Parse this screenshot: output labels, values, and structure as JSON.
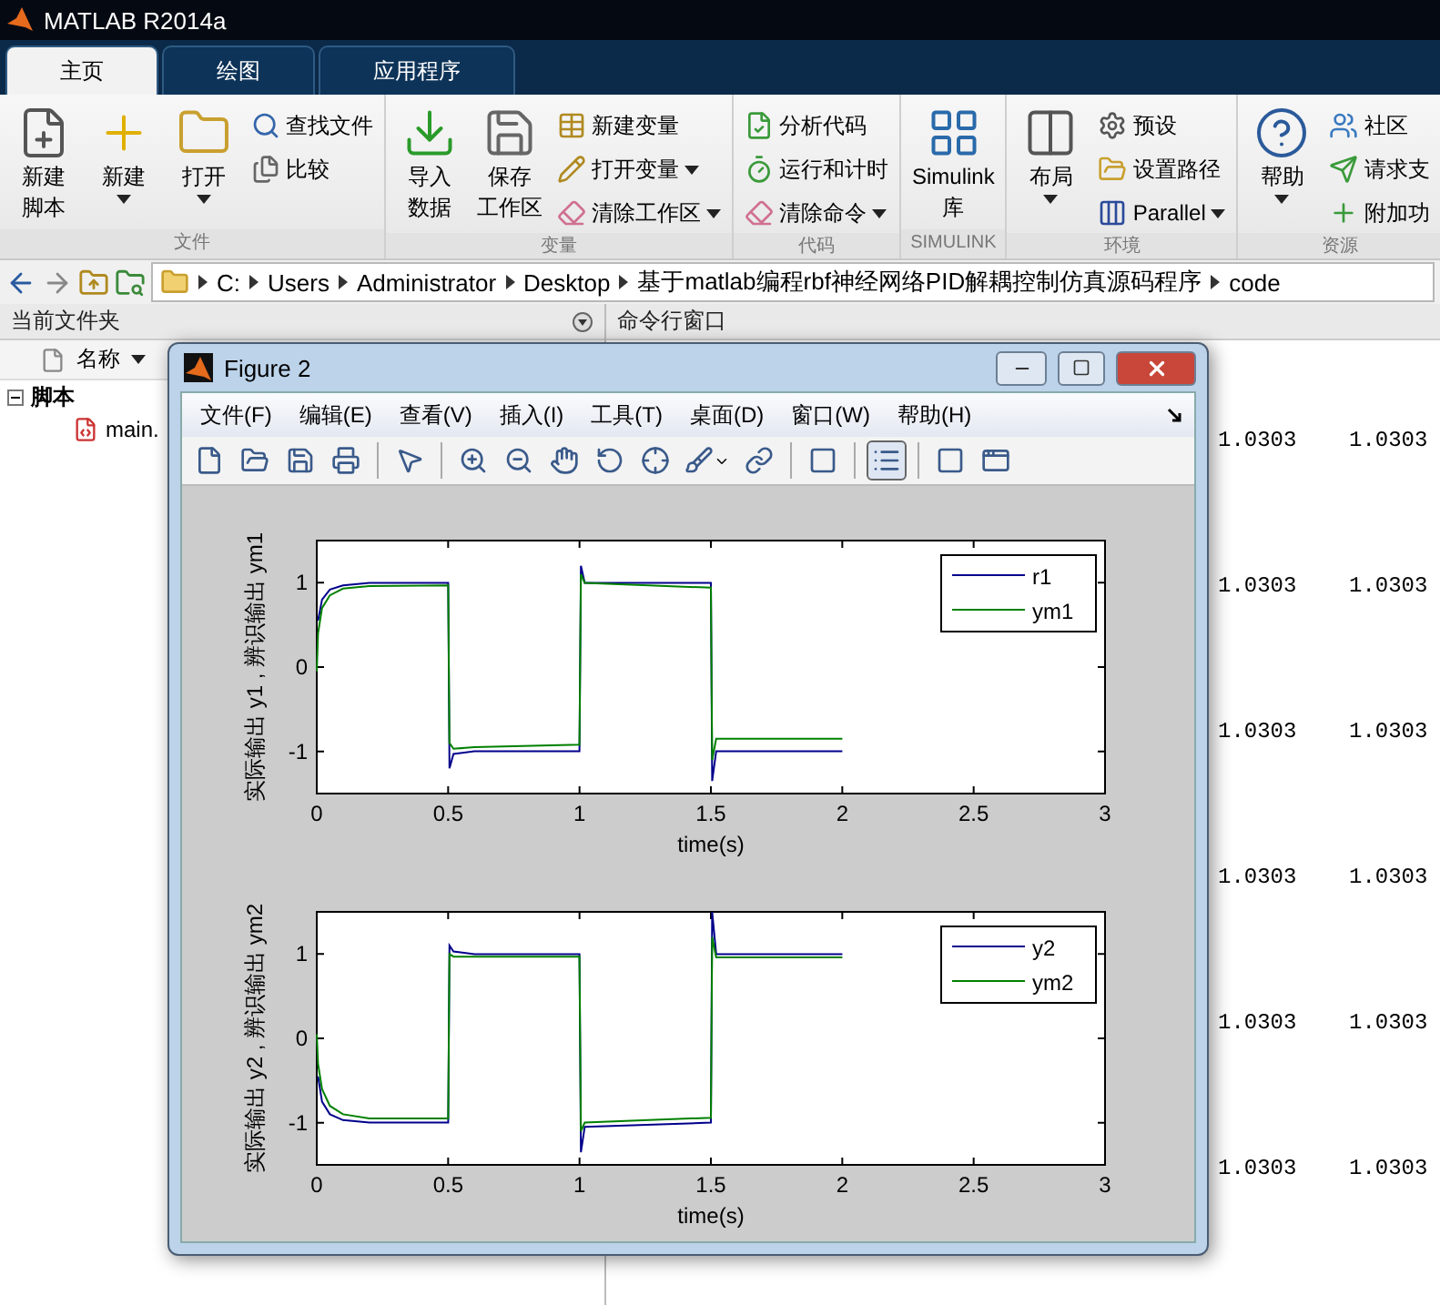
{
  "window": {
    "title": "MATLAB R2014a"
  },
  "tabs": [
    {
      "label": "主页",
      "selected": true
    },
    {
      "label": "绘图",
      "selected": false
    },
    {
      "label": "应用程序",
      "selected": false
    }
  ],
  "ribbon": [
    {
      "label": "文件",
      "items": [
        {
          "kind": "large",
          "lines": [
            "新建",
            "脚本"
          ],
          "dropdown": false
        },
        {
          "kind": "large",
          "lines": [
            "新建"
          ],
          "dropdown": true
        },
        {
          "kind": "large",
          "lines": [
            "打开"
          ],
          "dropdown": true
        },
        {
          "kind": "stack",
          "entries": [
            {
              "label": "查找文件",
              "dropdown": false
            },
            {
              "label": "比较",
              "dropdown": false
            }
          ]
        }
      ]
    },
    {
      "label": "变量",
      "items": [
        {
          "kind": "large",
          "lines": [
            "导入",
            "数据"
          ],
          "dropdown": false
        },
        {
          "kind": "large",
          "lines": [
            "保存",
            "工作区"
          ],
          "dropdown": false
        },
        {
          "kind": "stack",
          "entries": [
            {
              "label": "新建变量",
              "dropdown": false
            },
            {
              "label": "打开变量",
              "dropdown": true
            },
            {
              "label": "清除工作区",
              "dropdown": true
            }
          ]
        }
      ]
    },
    {
      "label": "代码",
      "items": [
        {
          "kind": "stack",
          "entries": [
            {
              "label": "分析代码",
              "dropdown": false
            },
            {
              "label": "运行和计时",
              "dropdown": false
            },
            {
              "label": "清除命令",
              "dropdown": true
            }
          ]
        }
      ]
    },
    {
      "label": "SIMULINK",
      "items": [
        {
          "kind": "large",
          "lines": [
            "Simulink",
            "库"
          ],
          "dropdown": false
        }
      ]
    },
    {
      "label": "环境",
      "items": [
        {
          "kind": "large",
          "lines": [
            "布局"
          ],
          "dropdown": true
        },
        {
          "kind": "stack",
          "entries": [
            {
              "label": "预设",
              "dropdown": false
            },
            {
              "label": "设置路径",
              "dropdown": false
            },
            {
              "label": "Parallel",
              "dropdown": true
            }
          ]
        }
      ]
    },
    {
      "label": "资源",
      "items": [
        {
          "kind": "large",
          "lines": [
            "帮助"
          ],
          "dropdown": true
        },
        {
          "kind": "stack",
          "entries": [
            {
              "label": "社区",
              "dropdown": false
            },
            {
              "label": "请求支",
              "dropdown": false
            },
            {
              "label": "附加功",
              "dropdown": false
            }
          ]
        }
      ]
    }
  ],
  "address": [
    "C:",
    "Users",
    "Administrator",
    "Desktop",
    "基于matlab编程rbf神经网络PID解耦控制仿真源码程序",
    "code"
  ],
  "current_folder": {
    "title": "当前文件夹",
    "column": "名称",
    "tree": [
      {
        "label": "脚本",
        "expanded": true,
        "children": [
          {
            "label": "main."
          }
        ]
      }
    ]
  },
  "command_window": {
    "title": "命令行窗口",
    "rows": [
      [
        "1.0303",
        "1.0303"
      ],
      [
        "1.0303",
        "1.0303"
      ],
      [
        "1.0303",
        "1.0303"
      ],
      [
        "1.0303",
        "1.0303"
      ],
      [
        "1.0303",
        "1.0303"
      ],
      [
        "1.0303",
        "1.0303"
      ]
    ]
  },
  "figure": {
    "title": "Figure 2",
    "menus": [
      "文件(F)",
      "编辑(E)",
      "查看(V)",
      "插入(I)",
      "工具(T)",
      "桌面(D)",
      "窗口(W)",
      "帮助(H)"
    ],
    "toolbar": [
      {
        "pressed": false
      },
      {
        "pressed": false
      },
      {
        "pressed": false
      },
      {
        "pressed": false
      },
      {
        "pressed": false
      },
      {
        "pressed": false
      },
      {
        "pressed": false
      },
      {
        "pressed": false
      },
      {
        "pressed": false
      },
      {
        "pressed": false
      },
      {
        "pressed": false
      },
      {
        "pressed": false
      },
      {
        "pressed": false
      },
      {
        "pressed": true
      },
      {
        "pressed": false
      },
      {
        "pressed": false
      }
    ],
    "axes": [
      {
        "chart_data": {
          "type": "line",
          "xlabel": "time(s)",
          "ylabel": "实际输出 y1 , 辨识输出 ym1",
          "x": [
            0,
            0.005,
            0.02,
            0.05,
            0.1,
            0.2,
            0.5,
            0.505,
            0.52,
            0.6,
            1.0,
            1.005,
            1.02,
            1.5,
            1.505,
            1.52,
            2.0
          ],
          "series": [
            {
              "name": "r1",
              "color": "#00008b",
              "values": [
                null,
                0.55,
                0.8,
                0.92,
                0.97,
                1,
                1,
                -1.2,
                -1.03,
                -1,
                -1,
                1.2,
                1.0,
                1.0,
                -1.35,
                -1.0,
                -1.0
              ]
            },
            {
              "name": "ym1",
              "color": "#008000",
              "values": [
                -0.05,
                0.4,
                0.7,
                0.85,
                0.93,
                0.96,
                0.97,
                -0.9,
                -0.97,
                -0.95,
                -0.92,
                1.1,
                1.0,
                0.94,
                -1.1,
                -0.85,
                -0.85
              ]
            }
          ],
          "legend": "upper right",
          "xlim": [
            0,
            3
          ],
          "ylim": [
            -1.5,
            1.5
          ],
          "xticks": [
            0,
            0.5,
            1,
            1.5,
            2,
            2.5,
            3
          ],
          "yticks": [
            -1,
            0,
            1
          ]
        }
      },
      {
        "chart_data": {
          "type": "line",
          "xlabel": "time(s)",
          "ylabel": "实际输出 y2 , 辨识输出 ym2",
          "x": [
            0,
            0.005,
            0.02,
            0.05,
            0.1,
            0.2,
            0.5,
            0.505,
            0.52,
            0.6,
            1.0,
            1.005,
            1.02,
            1.5,
            1.505,
            1.52,
            2.0
          ],
          "series": [
            {
              "name": "y2",
              "color": "#00008b",
              "values": [
                null,
                -0.45,
                -0.75,
                -0.9,
                -0.97,
                -1,
                -1,
                1.1,
                1.03,
                1,
                1,
                -1.35,
                -1.05,
                -1.0,
                1.5,
                1.0,
                1.0
              ]
            },
            {
              "name": "ym2",
              "color": "#008000",
              "values": [
                0.05,
                -0.3,
                -0.6,
                -0.8,
                -0.9,
                -0.95,
                -0.95,
                1.0,
                0.97,
                0.97,
                0.97,
                -1.1,
                -1.0,
                -0.94,
                1.2,
                0.96,
                0.96
              ]
            }
          ],
          "legend": "upper right",
          "xlim": [
            0,
            3
          ],
          "ylim": [
            -1.5,
            1.5
          ],
          "xticks": [
            0,
            0.5,
            1,
            1.5,
            2,
            2.5,
            3
          ],
          "yticks": [
            -1,
            0,
            1
          ]
        }
      }
    ]
  }
}
